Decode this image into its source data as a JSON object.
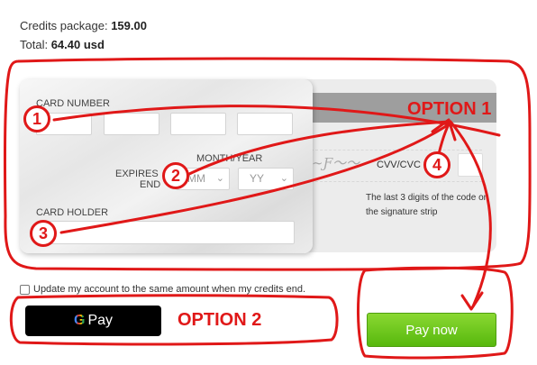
{
  "summary": {
    "package_label": "Credits package:",
    "package_value": "159.00",
    "total_label": "Total:",
    "total_value": "64.40 usd"
  },
  "card": {
    "number_label": "CARD NUMBER",
    "expires_label_1": "EXPIRES",
    "expires_label_2": "END",
    "month_year_label": "MONTH/YEAR",
    "month_placeholder": "MM",
    "year_placeholder": "YY",
    "holder_label": "CARD HOLDER",
    "holder_value": "",
    "cvv_label": "CVV/CVC",
    "cvv_help": "The last 3 digits of the code on the signature strip"
  },
  "update_account_label": "Update my account to the same amount when my credits end.",
  "gpay": {
    "g": "G",
    "label": "Pay"
  },
  "pay_now_label": "Pay now",
  "annotations": {
    "option1": "OPTION 1",
    "option2": "OPTION 2",
    "steps": [
      "1",
      "2",
      "3",
      "4"
    ],
    "color": "#e01818"
  },
  "colors": {
    "pay_button": "#6ac81f",
    "gpay_button": "#000000",
    "stripe": "#9e9e9e"
  }
}
